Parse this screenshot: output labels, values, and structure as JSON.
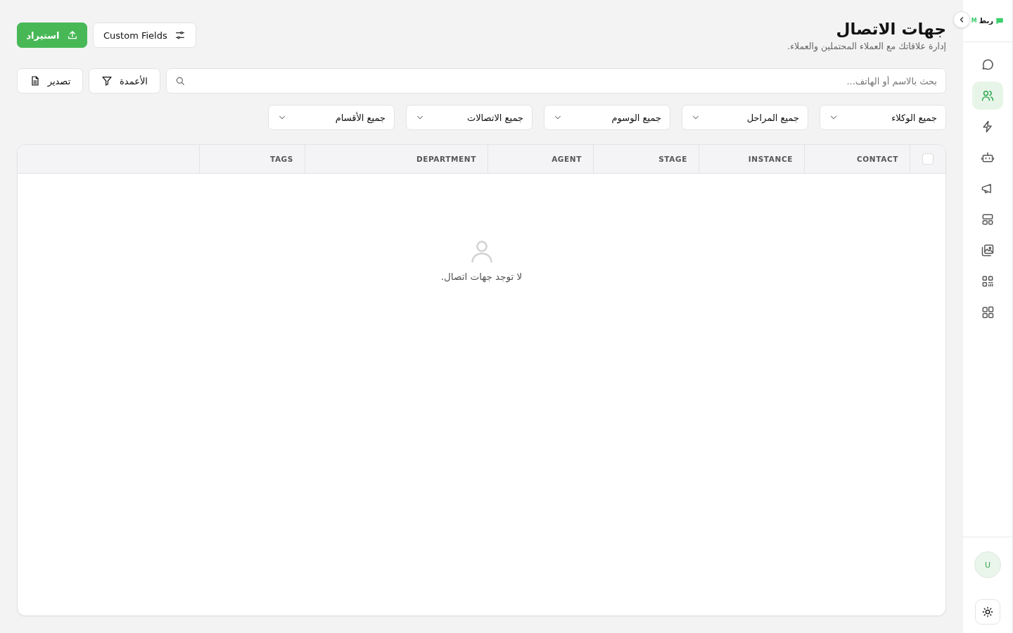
{
  "sidebar": {
    "logo": {
      "name": "ربط",
      "suffix": "M"
    },
    "nav": [
      {
        "selected": false
      },
      {
        "selected": true
      },
      {
        "selected": false
      },
      {
        "selected": false
      },
      {
        "selected": false
      },
      {
        "selected": false
      },
      {
        "selected": false
      },
      {
        "selected": false
      },
      {
        "selected": false
      }
    ],
    "avatar": "U"
  },
  "header": {
    "title": "جهات الاتصال",
    "subtitle": "إدارة علاقاتك مع العملاء المحتملين والعملاء.",
    "buttons": [
      {
        "label": "Custom Fields",
        "kind": "secondary"
      },
      {
        "label": "استيراد",
        "kind": "primary"
      }
    ]
  },
  "toolbar": {
    "search": {
      "placeholder": "بحث بالاسم أو الهاتف..."
    },
    "buttons": [
      {
        "label": "الأعمدة",
        "kind": "columns"
      },
      {
        "label": "تصدير",
        "kind": "export"
      }
    ]
  },
  "filters": [
    "جميع الوكلاء",
    "جميع المراحل",
    "جميع الوسوم",
    "جميع الاتصالات",
    "جميع الأقسام"
  ],
  "table": {
    "select_all": {
      "checked": false
    },
    "columns": [
      "CONTACT",
      "INSTANCE",
      "STAGE",
      "AGENT",
      "DEPARTMENT",
      "TAGS"
    ],
    "empty_message": "لا توجد جهات اتصال."
  }
}
